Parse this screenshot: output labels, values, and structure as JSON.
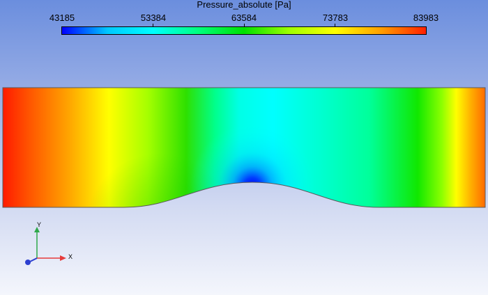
{
  "legend": {
    "title": "Pressure_absolute [Pa]",
    "labels": [
      "43185",
      "53384",
      "63584",
      "73783",
      "83983"
    ],
    "colors": [
      "#0000ff",
      "#00c8ff",
      "#00ffff",
      "#00ff80",
      "#00e000",
      "#a0ff00",
      "#ffff00",
      "#ffa000",
      "#ff2000"
    ]
  },
  "triad": {
    "y_label": "Y",
    "x_label": "X",
    "y_color": "#2ea84a",
    "x_color": "#e63b3b",
    "z_color": "#2c3fd0"
  }
}
